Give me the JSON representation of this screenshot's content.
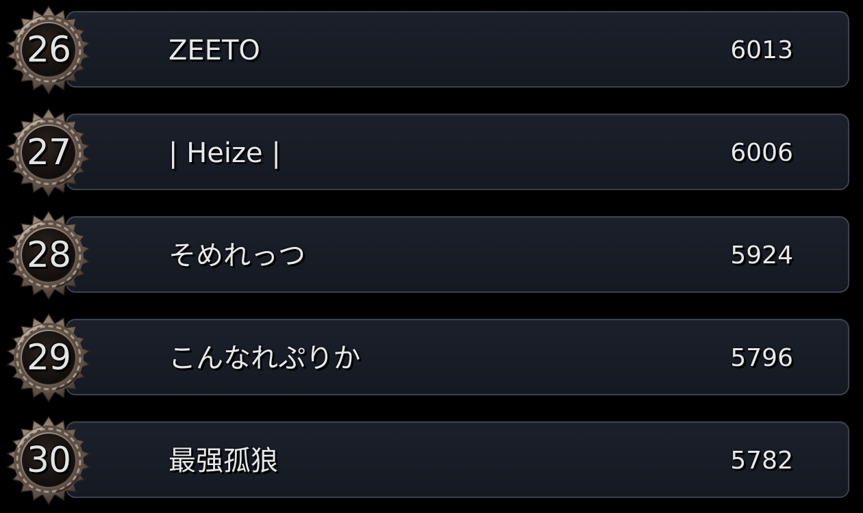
{
  "leaderboard": {
    "entries": [
      {
        "rank": "26",
        "name": "ZEETO",
        "score": "6013"
      },
      {
        "rank": "27",
        "name": "| Heize |",
        "score": "6006"
      },
      {
        "rank": "28",
        "name": "そめれっつ",
        "score": "5924"
      },
      {
        "rank": "29",
        "name": "こんなれぷりか",
        "score": "5796"
      },
      {
        "rank": "30",
        "name": "最强孤狼",
        "score": "5782"
      }
    ]
  },
  "colors": {
    "background": "#000000",
    "panel": "#171c25",
    "panel_border": "#3b4250",
    "text": "#e6e8ec",
    "badge_frame": "#8a7a6c",
    "badge_inner": "#1a1512"
  },
  "icons": {
    "rank_badge": "ornate-gear-frame-icon"
  }
}
